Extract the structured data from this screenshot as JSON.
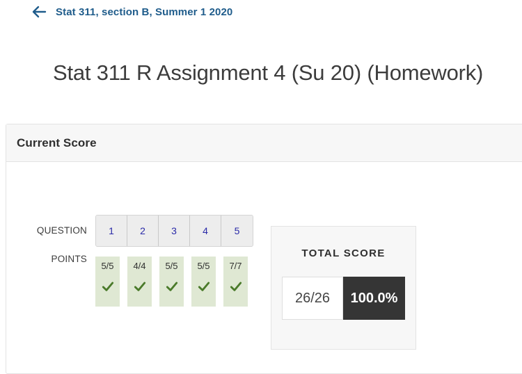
{
  "back_link": {
    "icon": "arrow-left-icon",
    "label": "Stat 311, section B, Summer 1 2020"
  },
  "page_title": "Stat 311 R Assignment 4 (Su 20) (Homework)",
  "card": {
    "header_title": "Current Score",
    "question_row_label": "QUESTION",
    "points_row_label": "POINTS",
    "questions": [
      "1",
      "2",
      "3",
      "4",
      "5"
    ],
    "points": [
      {
        "value": "5/5",
        "icon": "check-icon"
      },
      {
        "value": "4/4",
        "icon": "check-icon"
      },
      {
        "value": "5/5",
        "icon": "check-icon"
      },
      {
        "value": "5/5",
        "icon": "check-icon"
      },
      {
        "value": "7/7",
        "icon": "check-icon"
      }
    ],
    "total": {
      "caption": "TOTAL SCORE",
      "fraction": "26/26",
      "percent": "100.0%"
    }
  },
  "colors": {
    "link_blue": "#1f5c8b",
    "question_number_blue": "#2a2aa8",
    "points_tile_green": "#dfe8d3",
    "check_green": "#4a7a2a",
    "percent_dark": "#353535"
  }
}
